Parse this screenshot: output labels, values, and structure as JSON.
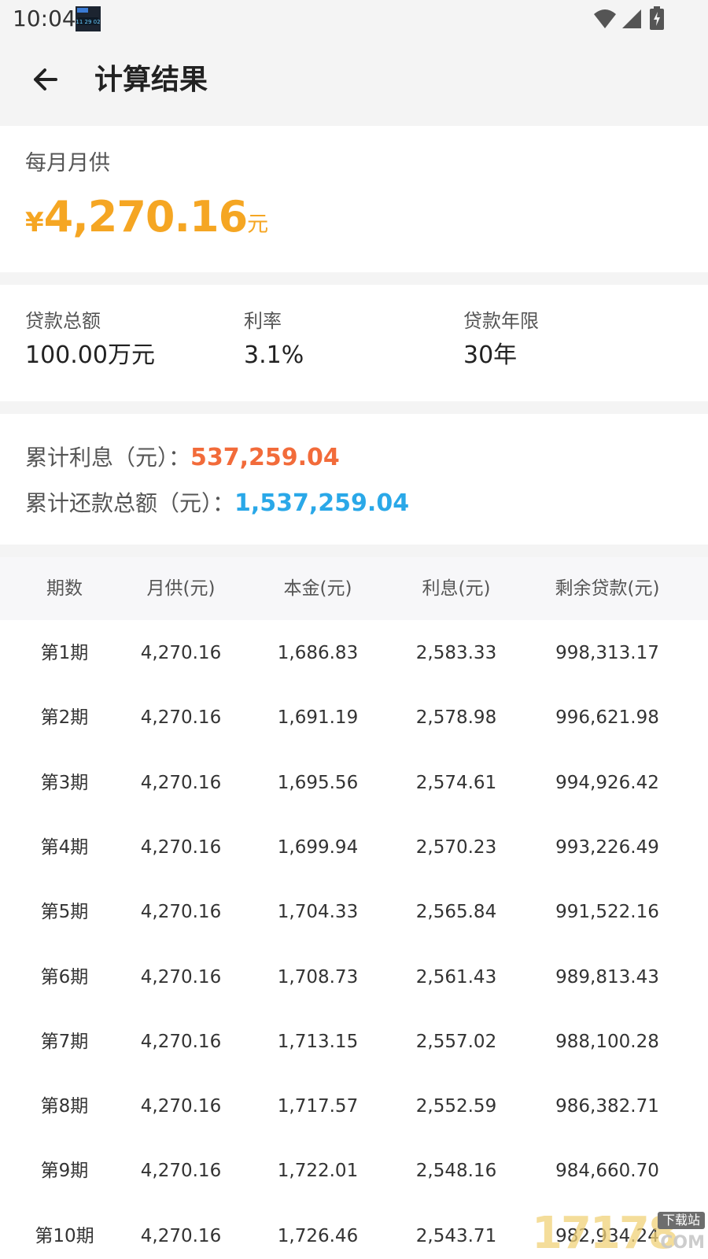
{
  "status_bar": {
    "time": "10:04",
    "icons": [
      "notification-thumbnail-icon",
      "wifi-icon",
      "signal-icon",
      "battery-charging-icon"
    ]
  },
  "app_bar": {
    "back_icon": "arrow-left-icon",
    "title": "计算结果"
  },
  "monthly": {
    "label": "每月月供",
    "currency_symbol": "¥",
    "amount": "4,270.16",
    "unit": "元",
    "color": "#f5a623"
  },
  "summary": {
    "loan_total_label": "贷款总额",
    "loan_total_value": "100.00万元",
    "rate_label": "利率",
    "rate_value": "3.1%",
    "term_label": "贷款年限",
    "term_value": "30年"
  },
  "totals": {
    "interest_label": "累计利息（元）：",
    "interest_value": "537,259.04",
    "interest_color": "#f26b3a",
    "repay_label": "累计还款总额（元）：",
    "repay_value": "1,537,259.04",
    "repay_color": "#2aa8e8"
  },
  "table": {
    "headers": [
      "期数",
      "月供(元)",
      "本金(元)",
      "利息(元)",
      "剩余贷款(元)"
    ],
    "rows": [
      [
        "第1期",
        "4,270.16",
        "1,686.83",
        "2,583.33",
        "998,313.17"
      ],
      [
        "第2期",
        "4,270.16",
        "1,691.19",
        "2,578.98",
        "996,621.98"
      ],
      [
        "第3期",
        "4,270.16",
        "1,695.56",
        "2,574.61",
        "994,926.42"
      ],
      [
        "第4期",
        "4,270.16",
        "1,699.94",
        "2,570.23",
        "993,226.49"
      ],
      [
        "第5期",
        "4,270.16",
        "1,704.33",
        "2,565.84",
        "991,522.16"
      ],
      [
        "第6期",
        "4,270.16",
        "1,708.73",
        "2,561.43",
        "989,813.43"
      ],
      [
        "第7期",
        "4,270.16",
        "1,713.15",
        "2,557.02",
        "988,100.28"
      ],
      [
        "第8期",
        "4,270.16",
        "1,717.57",
        "2,552.59",
        "986,382.71"
      ],
      [
        "第9期",
        "4,270.16",
        "1,722.01",
        "2,548.16",
        "984,660.70"
      ],
      [
        "第10期",
        "4,270.16",
        "1,726.46",
        "2,543.71",
        "982,934.24"
      ]
    ]
  },
  "watermark": {
    "number": "17178",
    "badge": "下载站",
    "suffix": "COM"
  }
}
